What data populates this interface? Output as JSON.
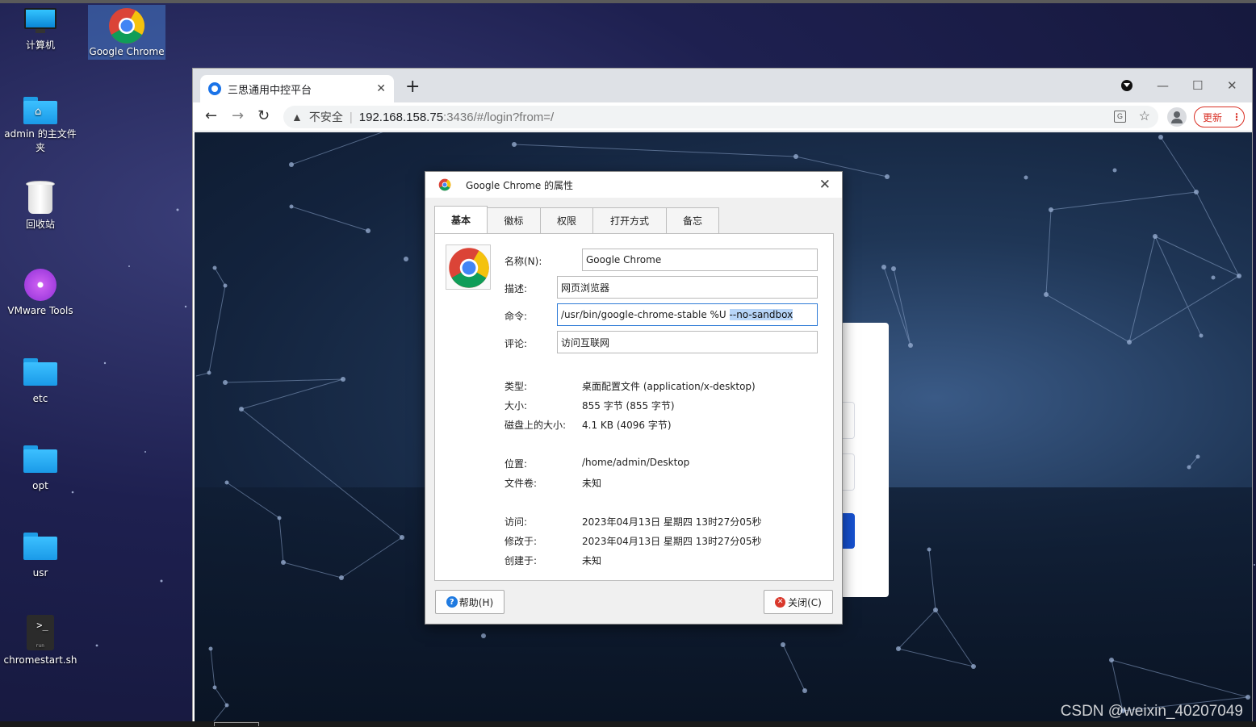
{
  "desktop": {
    "icons": [
      {
        "label": "计算机"
      },
      {
        "label": "Google Chrome"
      },
      {
        "label": "admin 的主文件夹"
      },
      {
        "label": "回收站"
      },
      {
        "label": "VMware Tools"
      },
      {
        "label": "etc"
      },
      {
        "label": "opt"
      },
      {
        "label": "usr"
      },
      {
        "label": "chromestart.sh"
      }
    ]
  },
  "browser": {
    "tab_title": "三思通用中控平台",
    "tab_close": "✕",
    "new_tab": "+",
    "insecure_label": "不安全",
    "url_host": "192.168.158.75",
    "url_path": ":3436/#/login?from=/",
    "update_label": "更新"
  },
  "dialog": {
    "title": "Google Chrome 的属性",
    "tabs": [
      "基本",
      "徽标",
      "权限",
      "打开方式",
      "备忘"
    ],
    "active_tab": "基本",
    "fields": {
      "name_label": "名称(N):",
      "name_value": "Google Chrome",
      "desc_label": "描述:",
      "desc_value": "网页浏览器",
      "cmd_label": "命令:",
      "cmd_value": "/usr/bin/google-chrome-stable %U ",
      "cmd_selected": "--no-sandbox",
      "comment_label": "评论:",
      "comment_value": "访问互联网"
    },
    "info": {
      "type_label": "类型:",
      "type_value": "桌面配置文件 (application/x-desktop)",
      "size_label": "大小:",
      "size_value": "855 字节 (855 字节)",
      "disk_label": "磁盘上的大小:",
      "disk_value": "4.1 KB (4096 字节)",
      "location_label": "位置:",
      "location_value": "/home/admin/Desktop",
      "volume_label": "文件卷:",
      "volume_value": "未知",
      "access_label": "访问:",
      "access_value": "2023年04月13日 星期四 13时27分05秒",
      "modified_label": "修改于:",
      "modified_value": "2023年04月13日 星期四 13时27分05秒",
      "created_label": "创建于:",
      "created_value": "未知"
    },
    "help_button": "帮助(H)",
    "close_button": "关闭(C)"
  },
  "watermark": "CSDN @weixin_40207049",
  "colors": {
    "accent": "#1a73e8",
    "update": "#d93025",
    "selection": "#b7d5f8"
  }
}
